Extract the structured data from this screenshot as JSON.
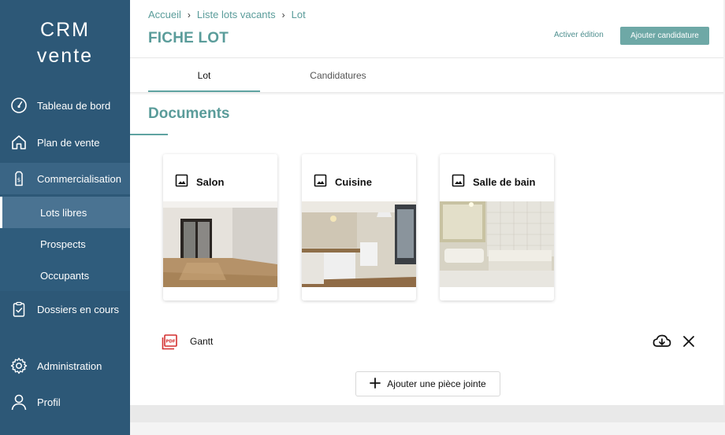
{
  "sidebar": {
    "brand_line1": "CRM",
    "brand_line2": "vente",
    "items": [
      {
        "label": "Tableau de bord",
        "icon": "gauge-icon"
      },
      {
        "label": "Plan de vente",
        "icon": "home-icon"
      },
      {
        "label": "Commercialisation",
        "icon": "price-tag-icon"
      },
      {
        "label": "Dossiers en cours",
        "icon": "clipboard-check-icon"
      },
      {
        "label": "Administration",
        "icon": "gear-icon"
      },
      {
        "label": "Profil",
        "icon": "user-icon"
      }
    ],
    "subitems": [
      {
        "label": "Lots libres",
        "selected": true
      },
      {
        "label": "Prospects",
        "selected": false
      },
      {
        "label": "Occupants",
        "selected": false
      }
    ]
  },
  "breadcrumb": [
    "Accueil",
    "Liste lots vacants",
    "Lot"
  ],
  "header": {
    "title": "FICHE LOT",
    "edit_link": "Activer édition",
    "add_button": "Ajouter candidature"
  },
  "tabs": [
    {
      "label": "Lot",
      "active": true
    },
    {
      "label": "Candidatures",
      "active": false
    }
  ],
  "documents": {
    "title": "Documents",
    "cards": [
      {
        "title": "Salon",
        "icon": "image-icon"
      },
      {
        "title": "Cuisine",
        "icon": "image-icon"
      },
      {
        "title": "Salle de bain",
        "icon": "image-icon"
      }
    ]
  },
  "attachments": [
    {
      "name": "Gantt",
      "icon": "pdf-icon"
    }
  ],
  "add_attachment_label": "Ajouter une pièce jointe",
  "colors": {
    "sidebar": "#2d5877",
    "accent": "#5a9c9a",
    "button": "#6ea8a6",
    "pdf": "#d32f2f"
  }
}
